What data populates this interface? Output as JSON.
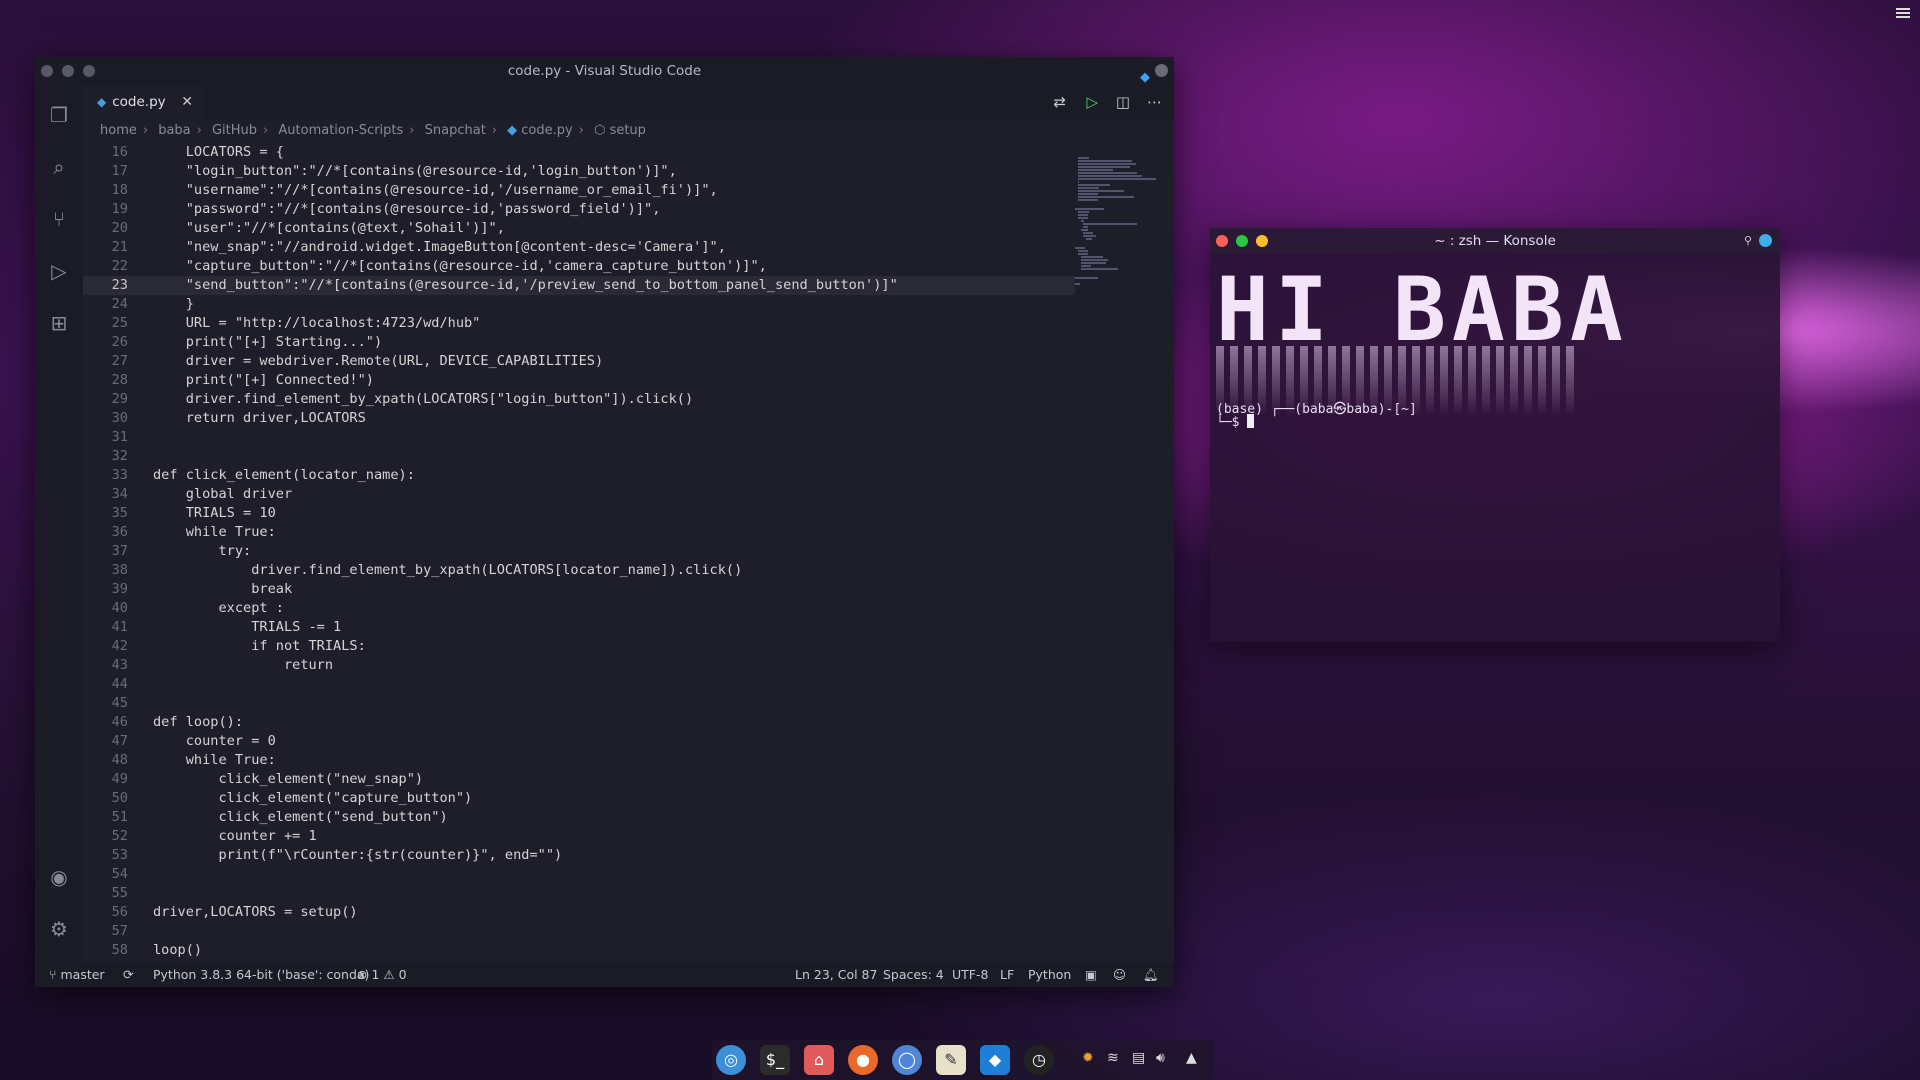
{
  "vscode": {
    "window_title": "code.py - Visual Studio Code",
    "tab_label": "code.py",
    "breadcrumb": [
      "home",
      "baba",
      "GitHub",
      "Automation-Scripts",
      "Snapchat",
      "code.py",
      "setup"
    ],
    "status": {
      "branch": "master",
      "interpreter": "Python 3.8.3 64-bit ('base': conda)",
      "problems": "1",
      "warnings": "0",
      "cursor": "Ln 23, Col 87",
      "spaces": "Spaces: 4",
      "encoding": "UTF-8",
      "eol": "LF",
      "language": "Python"
    },
    "code_lines": [
      {
        "n": "16",
        "t": "    LOCATORS = {"
      },
      {
        "n": "17",
        "t": "    \"login_button\":\"//*[contains(@resource-id,'login_button')]\","
      },
      {
        "n": "18",
        "t": "    \"username\":\"//*[contains(@resource-id,'/username_or_email_fi')]\","
      },
      {
        "n": "19",
        "t": "    \"password\":\"//*[contains(@resource-id,'password_field')]\","
      },
      {
        "n": "20",
        "t": "    \"user\":\"//*[contains(@text,'Sohail')]\","
      },
      {
        "n": "21",
        "t": "    \"new_snap\":\"//android.widget.ImageButton[@content-desc='Camera']\","
      },
      {
        "n": "22",
        "t": "    \"capture_button\":\"//*[contains(@resource-id,'camera_capture_button')]\","
      },
      {
        "n": "23",
        "t": "    \"send_button\":\"//*[contains(@resource-id,'/preview_send_to_bottom_panel_send_button')]\""
      },
      {
        "n": "24",
        "t": "    }"
      },
      {
        "n": "25",
        "t": "    URL = \"http://localhost:4723/wd/hub\""
      },
      {
        "n": "26",
        "t": "    print(\"[+] Starting...\")"
      },
      {
        "n": "27",
        "t": "    driver = webdriver.Remote(URL, DEVICE_CAPABILITIES)"
      },
      {
        "n": "28",
        "t": "    print(\"[+] Connected!\")"
      },
      {
        "n": "29",
        "t": "    driver.find_element_by_xpath(LOCATORS[\"login_button\"]).click()"
      },
      {
        "n": "30",
        "t": "    return driver,LOCATORS"
      },
      {
        "n": "31",
        "t": ""
      },
      {
        "n": "32",
        "t": ""
      },
      {
        "n": "33",
        "t": "def click_element(locator_name):"
      },
      {
        "n": "34",
        "t": "    global driver"
      },
      {
        "n": "35",
        "t": "    TRIALS = 10"
      },
      {
        "n": "36",
        "t": "    while True:"
      },
      {
        "n": "37",
        "t": "        try:"
      },
      {
        "n": "38",
        "t": "            driver.find_element_by_xpath(LOCATORS[locator_name]).click()"
      },
      {
        "n": "39",
        "t": "            break"
      },
      {
        "n": "40",
        "t": "        except :"
      },
      {
        "n": "41",
        "t": "            TRIALS -= 1"
      },
      {
        "n": "42",
        "t": "            if not TRIALS:"
      },
      {
        "n": "43",
        "t": "                return"
      },
      {
        "n": "44",
        "t": ""
      },
      {
        "n": "45",
        "t": ""
      },
      {
        "n": "46",
        "t": "def loop():"
      },
      {
        "n": "47",
        "t": "    counter = 0"
      },
      {
        "n": "48",
        "t": "    while True:"
      },
      {
        "n": "49",
        "t": "        click_element(\"new_snap\")"
      },
      {
        "n": "50",
        "t": "        click_element(\"capture_button\")"
      },
      {
        "n": "51",
        "t": "        click_element(\"send_button\")"
      },
      {
        "n": "52",
        "t": "        counter += 1"
      },
      {
        "n": "53",
        "t": "        print(f\"\\rCounter:{str(counter)}\", end=\"\")"
      },
      {
        "n": "54",
        "t": ""
      },
      {
        "n": "55",
        "t": ""
      },
      {
        "n": "56",
        "t": "driver,LOCATORS = setup()"
      },
      {
        "n": "57",
        "t": ""
      },
      {
        "n": "58",
        "t": "loop()"
      }
    ],
    "active_line": "23"
  },
  "konsole": {
    "window_title": "~ : zsh — Konsole",
    "banner": "HI BABA",
    "prompt_line1": "(base) ┌──(baba㉿baba)-[~]",
    "prompt_line2": "└─$ "
  },
  "taskbar": {
    "icons": [
      "elementary-icon",
      "terminal-icon",
      "files-icon",
      "firefox-icon",
      "chromium-icon",
      "text-editor-icon",
      "vscode-icon",
      "clock-icon"
    ],
    "tray": [
      "settings-icon",
      "wifi-icon",
      "clipboard-icon",
      "volume-icon",
      "tray-expand-icon"
    ]
  },
  "colors": {
    "accent": "#3daee9",
    "vscode_bg": "#1e1e2a"
  }
}
